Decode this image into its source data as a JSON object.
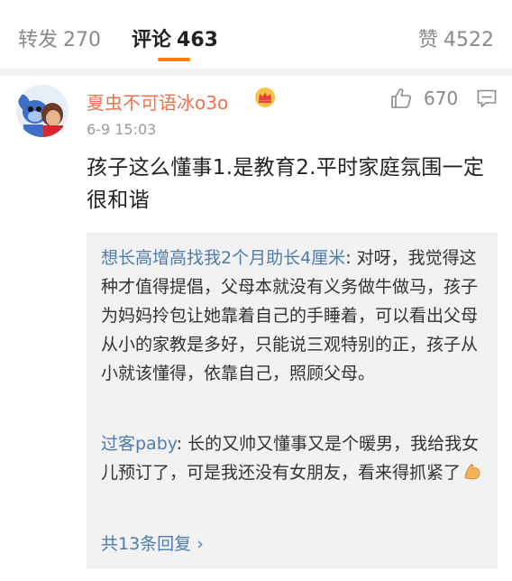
{
  "tabs": {
    "repost": {
      "label": "转发",
      "count": "270"
    },
    "comments": {
      "label": "评论",
      "count": "463"
    },
    "likes": {
      "label": "赞",
      "count": "4522"
    }
  },
  "comment": {
    "username": "夏虫不可语冰o3o",
    "timestamp": "6-9 15:03",
    "like_count": "670",
    "text": "孩子这么懂事1.是教育2.平时家庭氛围一定很和谐"
  },
  "replies": [
    {
      "author": "想长高增高找我2个月助长4厘米",
      "text": ": 对呀，我觉得这种才值得提倡，父母本就没有义务做牛做马，孩子为妈妈拎包让她靠着自己的手睡着，可以看出父母从小的家教是多好，只能说三观特别的正，孩子从小就该懂得，依靠自己，照顾父母。"
    },
    {
      "author": "过客paby",
      "text": ": 长的又帅又懂事又是个暖男，我给我女儿预订了，可是我还没有女朋友，看来得抓紧了"
    }
  ],
  "more_replies": {
    "label": "共13条回复",
    "chevron": "›"
  },
  "colors": {
    "accent": "#ff8200",
    "username": "#eb7350",
    "link": "#4f7cad"
  },
  "icons": [
    "avatar",
    "crown-icon",
    "like-icon",
    "reply-icon",
    "biceps-icon",
    "chevron-right-icon"
  ]
}
